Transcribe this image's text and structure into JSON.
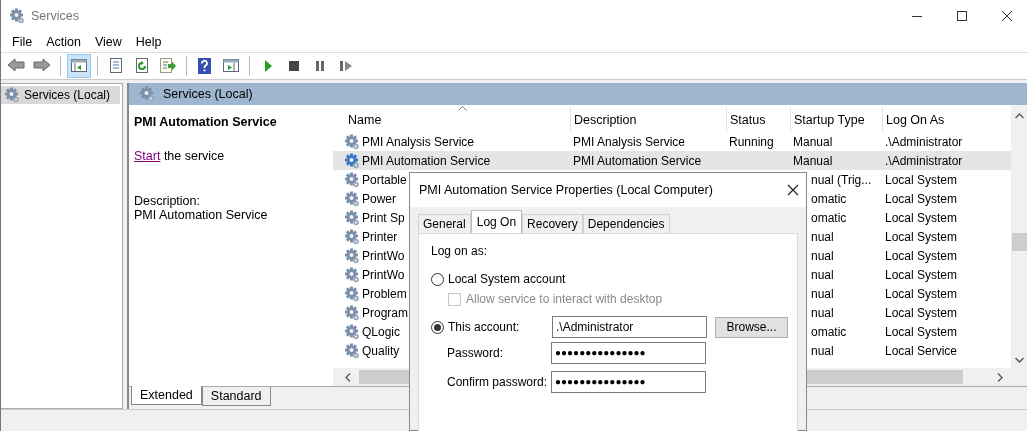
{
  "window": {
    "title": "Services"
  },
  "menu": [
    "File",
    "Action",
    "View",
    "Help"
  ],
  "toolbar": [
    [
      {
        "kind": "back",
        "selected": false
      },
      {
        "kind": "forward",
        "selected": false
      }
    ],
    [
      {
        "kind": "console-tree",
        "selected": true
      }
    ],
    [
      {
        "kind": "properties",
        "selected": false
      },
      {
        "kind": "refresh",
        "selected": false
      },
      {
        "kind": "export",
        "selected": false
      }
    ],
    [
      {
        "kind": "help",
        "selected": false
      },
      {
        "kind": "action-pane",
        "selected": false
      }
    ],
    [
      {
        "kind": "start",
        "selected": false
      },
      {
        "kind": "stop",
        "selected": false
      },
      {
        "kind": "pause",
        "selected": false
      },
      {
        "kind": "resume",
        "selected": false
      }
    ]
  ],
  "tree": {
    "items": [
      {
        "label": "Services (Local)",
        "selected": true
      }
    ]
  },
  "pane_header": "Services (Local)",
  "details": {
    "title": "PMI Automation Service",
    "action_link": "Start",
    "action_text": "the service",
    "description_label": "Description:",
    "description": "PMI Automation Service"
  },
  "table": {
    "columns": [
      {
        "label": "Name",
        "sorted": true
      },
      {
        "label": "Description",
        "sorted": false
      },
      {
        "label": "Status",
        "sorted": false
      },
      {
        "label": "Startup Type",
        "sorted": false
      },
      {
        "label": "Log On As",
        "sorted": false
      }
    ],
    "rows": [
      {
        "kind": "full",
        "name": "PMI Analysis Service",
        "description": "PMI Analysis Service",
        "status": "Running",
        "startup_type": "Manual",
        "log_on_as": ".\\Administrator",
        "selected": false
      },
      {
        "kind": "full",
        "name": "PMI Automation Service",
        "description": "PMI Automation Service",
        "startup_type": "Manual",
        "log_on_as": ".\\Administrator",
        "selected": true
      },
      {
        "kind": "covered",
        "name": "Portable",
        "startup_type": "nual (Trig...",
        "log_on_as": "Local System",
        "selected": false
      },
      {
        "kind": "covered",
        "name": "Power",
        "startup_type": "omatic",
        "log_on_as": "Local System",
        "selected": false
      },
      {
        "kind": "covered",
        "name": "Print Sp",
        "startup_type": "omatic",
        "log_on_as": "Local System",
        "selected": false
      },
      {
        "kind": "covered",
        "name": "Printer",
        "startup_type": "nual",
        "log_on_as": "Local System",
        "selected": false
      },
      {
        "kind": "covered",
        "name": "PrintWo",
        "startup_type": "nual",
        "log_on_as": "Local System",
        "selected": false
      },
      {
        "kind": "covered",
        "name": "PrintWo",
        "startup_type": "nual",
        "log_on_as": "Local System",
        "selected": false
      },
      {
        "kind": "covered",
        "name": "Problem",
        "startup_type": "nual",
        "log_on_as": "Local System",
        "selected": false
      },
      {
        "kind": "covered",
        "name": "Program",
        "startup_type": "nual",
        "log_on_as": "Local System",
        "selected": false
      },
      {
        "kind": "covered",
        "name": "QLogic",
        "startup_type": "omatic",
        "log_on_as": "Local System",
        "selected": false
      },
      {
        "kind": "covered",
        "name": "Quality",
        "startup_type": "nual",
        "log_on_as": "Local Service",
        "selected": false
      }
    ]
  },
  "view_tabs": [
    {
      "label": "Extended",
      "selected": true
    },
    {
      "label": "Standard",
      "selected": false
    }
  ],
  "dialog": {
    "title": "PMI Automation Service Properties (Local Computer)",
    "tabs": [
      {
        "label": "General",
        "selected": false
      },
      {
        "label": "Log On",
        "selected": true
      },
      {
        "label": "Recovery",
        "selected": false
      },
      {
        "label": "Dependencies",
        "selected": false
      }
    ],
    "log_on_label": "Log on as:",
    "options": [
      {
        "kind": "radio",
        "label": "Local System account",
        "selected": false
      },
      {
        "kind": "checkbox",
        "label": "Allow service to interact with desktop",
        "checked": false,
        "disabled": true
      },
      {
        "kind": "radio",
        "label": "This account:",
        "selected": true,
        "value": ".\\Administrator",
        "button": "Browse..."
      },
      {
        "kind": "password",
        "label": "Password:",
        "value": "●●●●●●●●●●●●●●●"
      },
      {
        "kind": "password",
        "label": "Confirm password:",
        "value": "●●●●●●●●●●●●●●●"
      }
    ]
  }
}
